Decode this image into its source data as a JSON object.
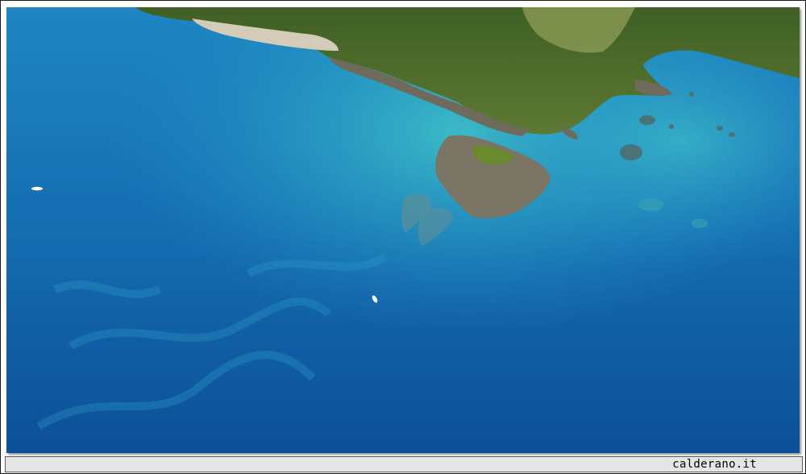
{
  "photo": {
    "icon": "aerial-sea-photo",
    "colors": {
      "deep_sea": "#0d5fa6",
      "mid_sea": "#1f86c2",
      "shallow_sea": "#2fb0c6",
      "vegetation": "#4f6f2c",
      "rock": "#6f6a5a",
      "sand": "#cfc7b4"
    }
  },
  "footer": {
    "watermark": "calderano.it"
  }
}
